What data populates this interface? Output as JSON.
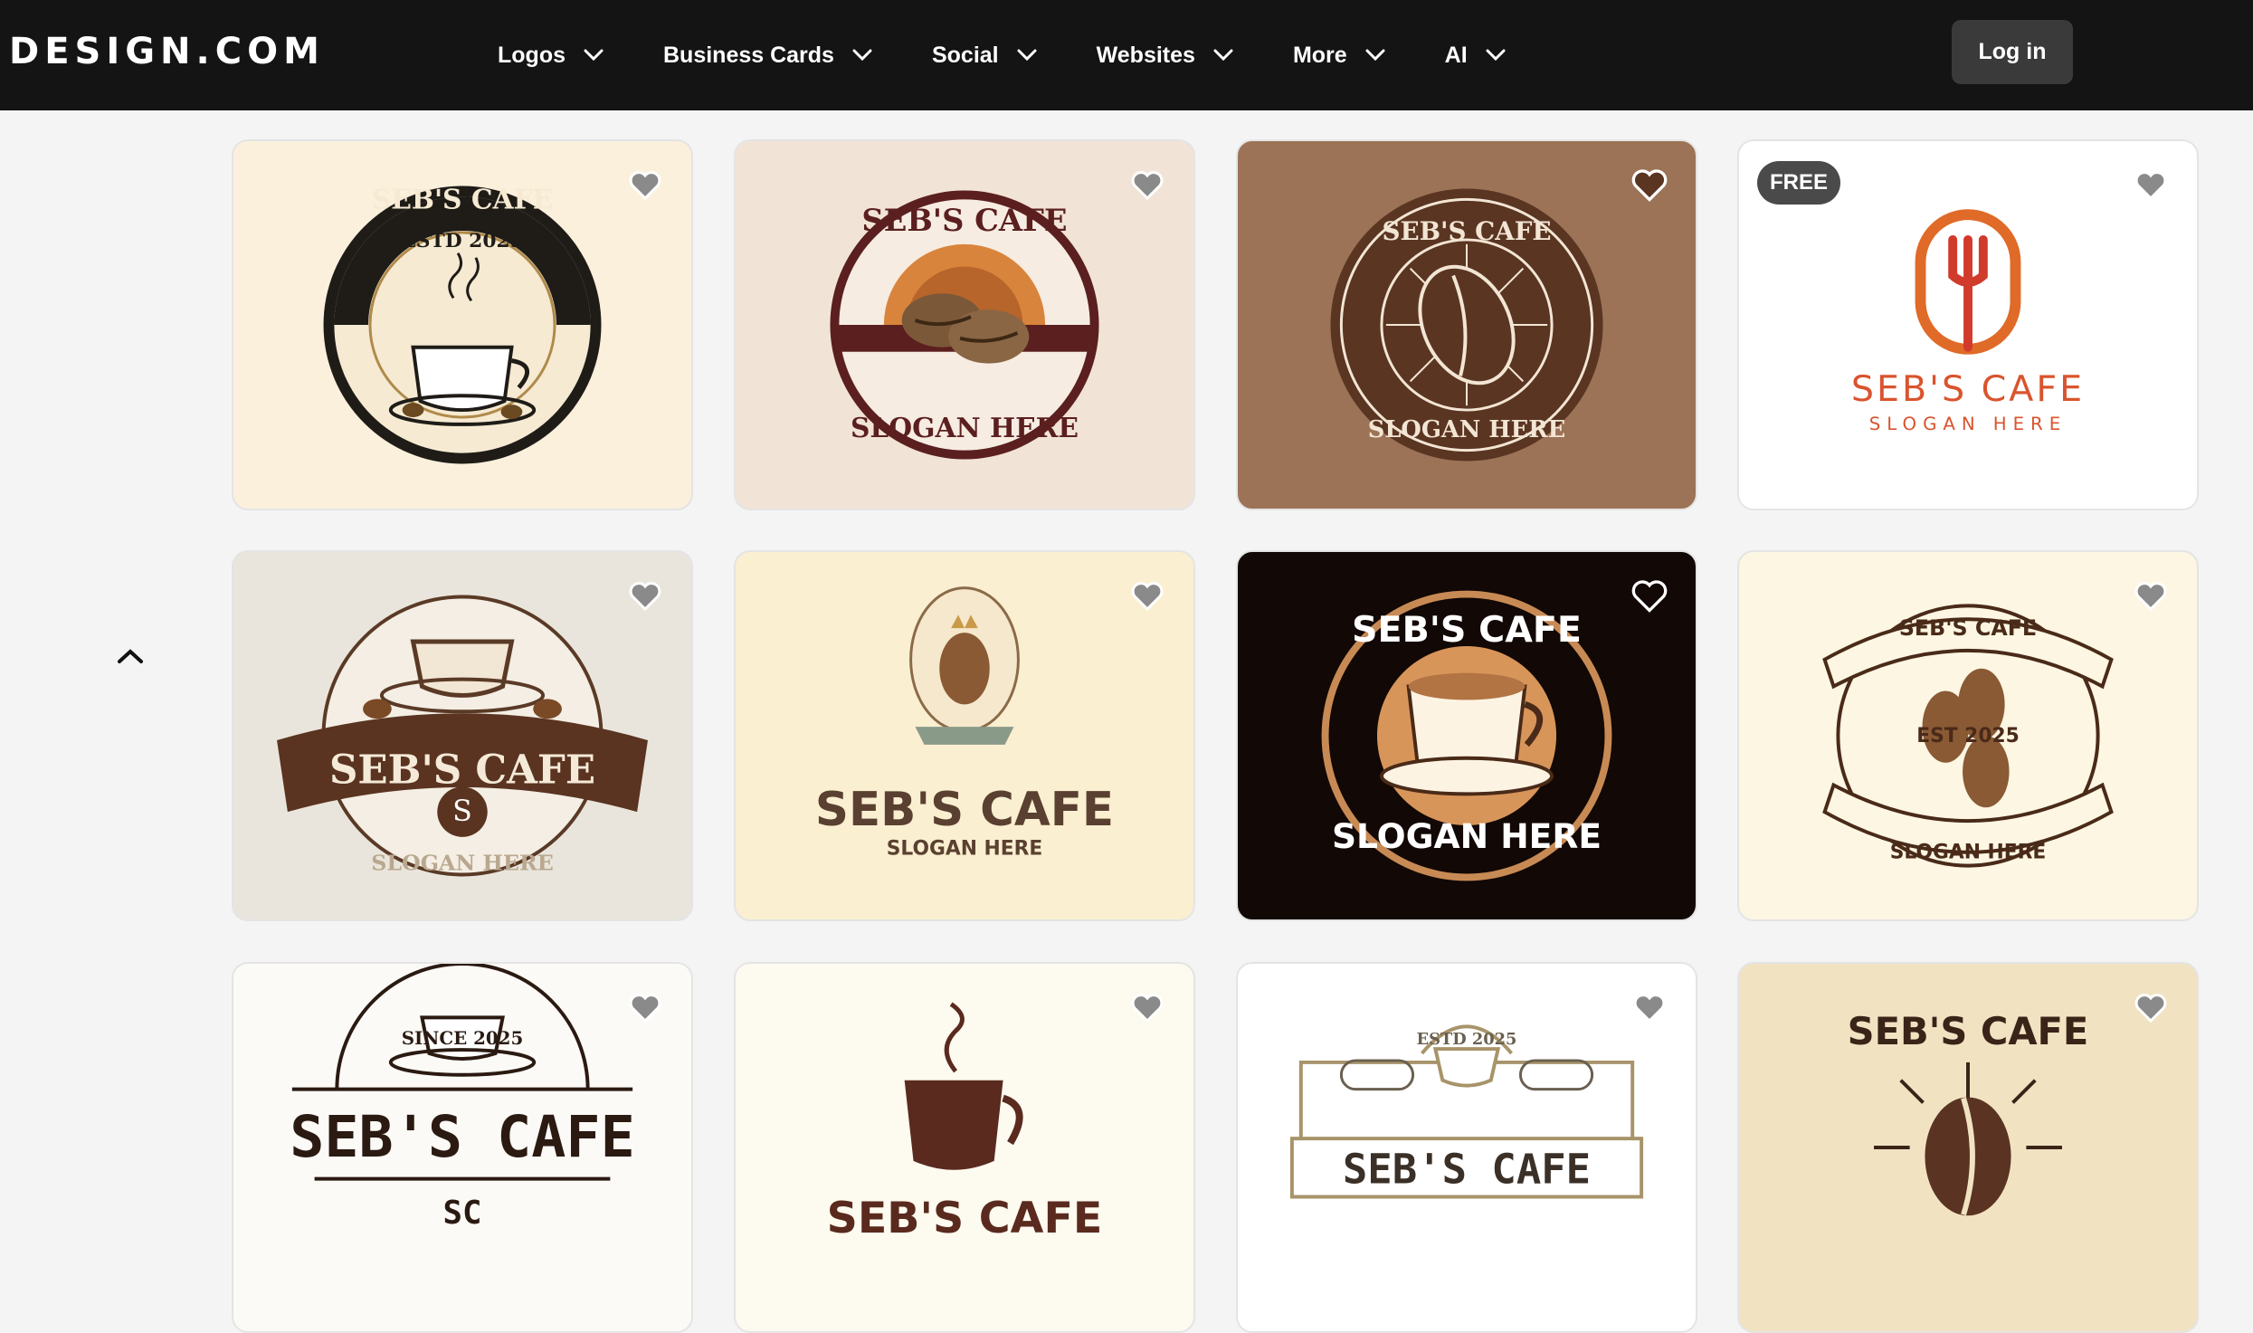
{
  "header": {
    "brand": "DESIGN.COM",
    "nav": [
      "Logos",
      "Business Cards",
      "Social",
      "Websites",
      "More",
      "AI"
    ],
    "login_label": "Log in"
  },
  "colors": {
    "header_bg": "#141414",
    "page_bg": "#f4f4f4",
    "login_bg": "#3a3a3a"
  },
  "cards": [
    {
      "name": "SEB'S CAFE",
      "slogan": "",
      "extra": "ESTD 2025",
      "bg": "#fbf0dc"
    },
    {
      "name": "SEB'S CAFE",
      "slogan": "SLOGAN HERE",
      "extra": "",
      "bg": "#f1e4d7"
    },
    {
      "name": "SEB'S CAFE",
      "slogan": "SLOGAN HERE",
      "extra": "",
      "bg": "#9c7356"
    },
    {
      "name": "SEB'S CAFE",
      "slogan": "SLOGAN HERE",
      "extra": "",
      "bg": "#ffffff",
      "badge": "FREE"
    },
    {
      "name": "SEB'S CAFE",
      "slogan": "SLOGAN HERE",
      "extra": "S",
      "bg": "#e9e5dc"
    },
    {
      "name": "SEB'S CAFE",
      "slogan": "SLOGAN HERE",
      "extra": "",
      "bg": "#faefd1"
    },
    {
      "name": "SEB'S CAFE",
      "slogan": "SLOGAN HERE",
      "extra": "",
      "bg": "#120805"
    },
    {
      "name": "SEB'S CAFE",
      "slogan": "SLOGAN HERE",
      "extra": "EST 2025",
      "bg": "#fcf6e3"
    },
    {
      "name": "SEB'S CAFE",
      "slogan": "SC",
      "extra": "SINCE 2025",
      "bg": "#fcfaf6"
    },
    {
      "name": "SEB'S CAFE",
      "slogan": "",
      "extra": "",
      "bg": "#fdfaef"
    },
    {
      "name": "SEB'S CAFE",
      "slogan": "",
      "extra": "ESTD 2025",
      "bg": "#ffffff"
    },
    {
      "name": "SEB'S CAFE",
      "slogan": "",
      "extra": "",
      "bg": "#f1e3c2"
    }
  ]
}
